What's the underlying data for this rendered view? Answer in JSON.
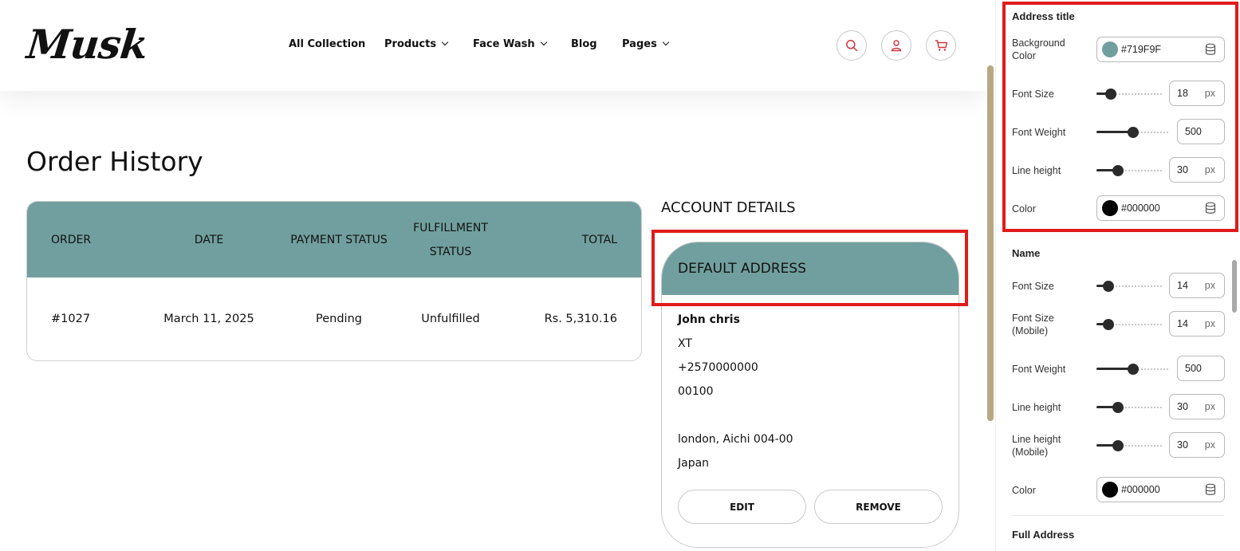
{
  "header": {
    "logo": "Musk",
    "nav": [
      {
        "label": "All Collection",
        "dropdown": false
      },
      {
        "label": "Products",
        "dropdown": true
      },
      {
        "label": "Face Wash",
        "dropdown": true
      },
      {
        "label": "Blog",
        "dropdown": false
      },
      {
        "label": "Pages",
        "dropdown": true
      }
    ],
    "icons": [
      "search-icon",
      "user-icon",
      "cart-icon"
    ],
    "icon_color": "#d0343b"
  },
  "page_title": "Order History",
  "orders": {
    "columns": [
      "ORDER",
      "DATE",
      "PAYMENT STATUS",
      "FULFILLMENT STATUS",
      "TOTAL"
    ],
    "header_bg": "#719F9F",
    "rows": [
      {
        "order": "#1027",
        "date": "March 11, 2025",
        "payment": "Pending",
        "fulfillment": "Unfulfilled",
        "total": "Rs. 5,310.16"
      }
    ]
  },
  "account": {
    "title": "ACCOUNT DETAILS",
    "address_title": "DEFAULT ADDRESS",
    "name": "John chris",
    "lines": [
      "XT",
      "+2570000000",
      "00100",
      "",
      "london, Aichi 004-00",
      "Japan"
    ],
    "edit_label": "EDIT",
    "remove_label": "REMOVE"
  },
  "highlight_color": "#e01b1b",
  "panel": {
    "address_title": {
      "title": "Address title",
      "bg_label": "Background Color",
      "bg_color": "#719F9F",
      "bg_hex": "#719F9F",
      "font_size_label": "Font Size",
      "font_size": "18",
      "font_weight_label": "Font Weight",
      "font_weight": "500",
      "line_height_label": "Line height",
      "line_height": "30",
      "color_label": "Color",
      "color": "#000000",
      "color_hex": "#000000"
    },
    "name": {
      "title": "Name",
      "font_size_label": "Font Size",
      "font_size": "14",
      "font_size_mobile_label": "Font Size (Mobile)",
      "font_size_mobile": "14",
      "font_weight_label": "Font Weight",
      "font_weight": "500",
      "line_height_label": "Line height",
      "line_height": "30",
      "line_height_mobile_label": "Line height (Mobile)",
      "line_height_mobile": "30",
      "color_label": "Color",
      "color": "#000000",
      "color_hex": "#000000"
    },
    "full_address": {
      "title": "Full Address"
    },
    "unit": "px"
  }
}
